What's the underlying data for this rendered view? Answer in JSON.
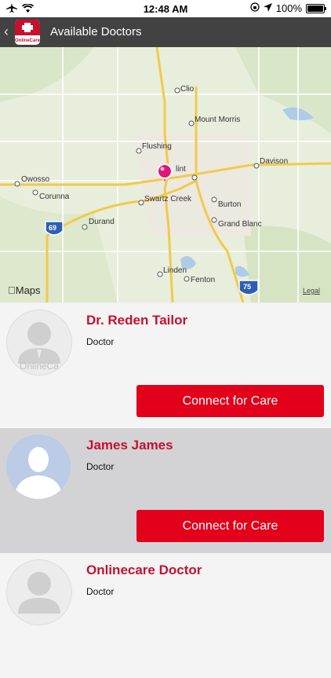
{
  "status": {
    "time": "12:48 AM",
    "battery": "100%",
    "battery_level": 1.0
  },
  "nav": {
    "title": "Available Doctors",
    "back": "‹",
    "logo_text": "OnlineCare"
  },
  "map": {
    "labels": [
      "Clio",
      "Mount Morris",
      "Flushing",
      "lint",
      "Davison",
      "Owosso",
      "Corunna",
      "Swartz Creek",
      "Burton",
      "Durand",
      "Grand Blanc",
      "Linden",
      "Fenton"
    ],
    "route_69": "69",
    "route_75": "75",
    "apple_maps": "Maps",
    "legal": "Legal"
  },
  "doctors": [
    {
      "name": "Dr. Reden Tailor",
      "role": "Doctor",
      "button": "Connect for Care",
      "avatar": "onlinecare-avatar",
      "avatar_text": "OnlineCa"
    },
    {
      "name": "James James",
      "role": "Doctor",
      "button": "Connect for Care",
      "avatar": "person-silhouette"
    },
    {
      "name": "Onlinecare Doctor",
      "role": "Doctor",
      "button": "",
      "avatar": "onlinecare-avatar"
    }
  ]
}
